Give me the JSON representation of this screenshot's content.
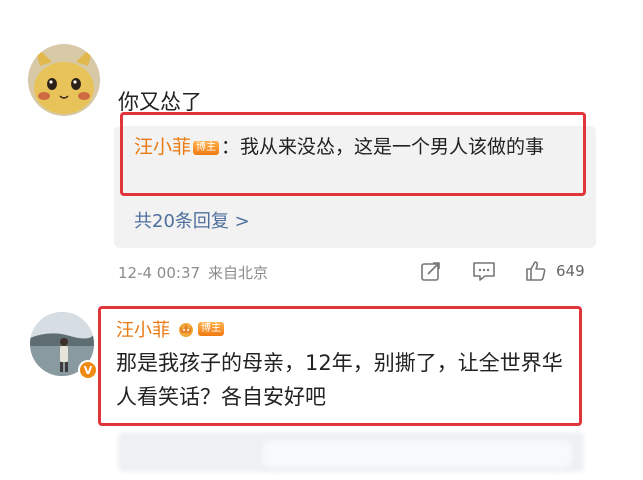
{
  "comment1": {
    "avatar_icon": "pikachu-avatar-icon",
    "username": "",
    "text": "你又怂了",
    "reply": {
      "author": "汪小菲",
      "badge": "博主",
      "text": "：我从来没怂，这是一个男人该做的事"
    },
    "reply_count_text": "共20条回复 >",
    "meta": {
      "date": "12-4 00:37",
      "location": "来自北京"
    },
    "actions": {
      "share_icon": "share-icon",
      "comment_icon": "comment-icon",
      "like_icon": "thumbs-up-icon",
      "like_count": "649"
    }
  },
  "comment2": {
    "avatar_icon": "person-photo-avatar-icon",
    "verified_badge": "V",
    "author": "汪小菲",
    "badge": "博主",
    "text": "那是我孩子的母亲，12年，别撕了，让全世界华人看笑话？各自安好吧"
  },
  "colors": {
    "highlight_border": "#e0353b",
    "author_orange": "#ea7a12",
    "link_blue": "#4e6f9e",
    "meta_gray": "#8c8c8c"
  }
}
